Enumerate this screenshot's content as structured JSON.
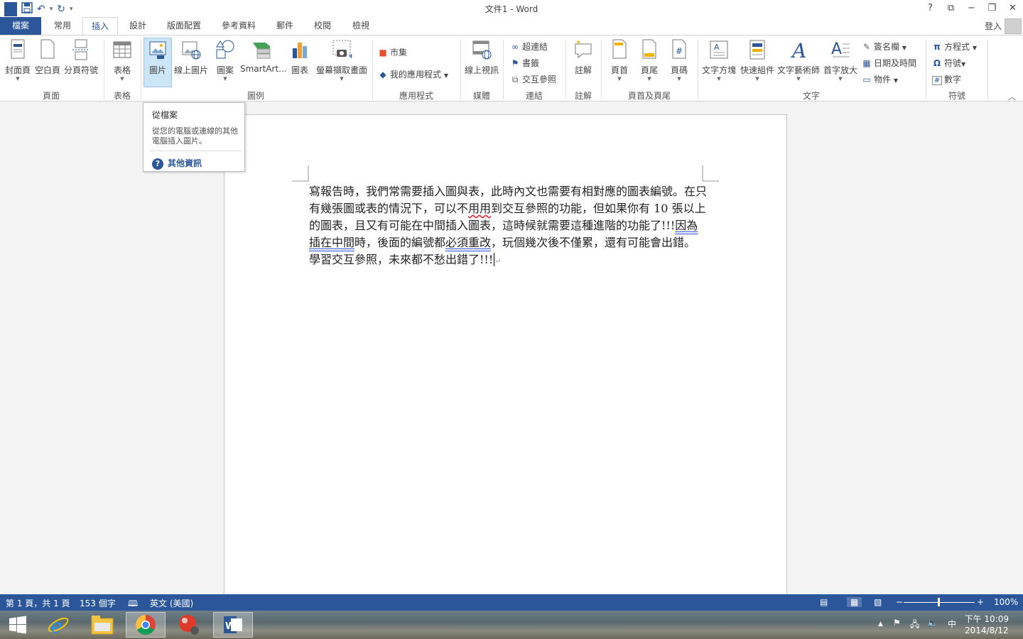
{
  "window": {
    "title": "文件1 - Word",
    "help": "?",
    "ribbon_display": "⧉",
    "restore": "❐",
    "close": "✕"
  },
  "qat": {
    "undo_arrow": "▾",
    "customize": "▾"
  },
  "tabs": [
    "檔案",
    "常用",
    "插入",
    "設計",
    "版面配置",
    "參考資料",
    "郵件",
    "校閱",
    "檢視"
  ],
  "active_tab": "插入",
  "account": {
    "login": "登入"
  },
  "ribbon": {
    "pages": {
      "cover": "封面頁",
      "blank": "空白頁",
      "break": "分頁符號",
      "group": "頁面"
    },
    "tables": {
      "table": "表格",
      "group": "表格"
    },
    "illustrations": {
      "picture": "圖片",
      "online": "線上圖片",
      "shapes": "圖案",
      "smartart": "SmartArt...",
      "chart": "圖表",
      "screenshot": "螢幕擷取畫面",
      "group": "圖例"
    },
    "apps": {
      "store": "市集",
      "myapps": "我的應用程式",
      "group": "應用程式"
    },
    "media": {
      "video": "線上視訊",
      "group": "媒體"
    },
    "links": {
      "hyperlink": "超連結",
      "bookmark": "書籤",
      "crossref": "交互參照",
      "group": "連結"
    },
    "comments": {
      "comment": "註解",
      "group": "註解"
    },
    "header_footer": {
      "header": "頁首",
      "footer": "頁尾",
      "pagenum": "頁碼",
      "group": "頁首及頁尾"
    },
    "text": {
      "textbox": "文字方塊",
      "quickparts": "快速組件",
      "wordart": "文字藝術師",
      "dropcap": "首字放大",
      "signature": "簽名欄",
      "datetime": "日期及時間",
      "object": "物件",
      "group": "文字"
    },
    "symbols": {
      "equation": "方程式",
      "symbol": "符號",
      "number": "數字",
      "group": "符號"
    }
  },
  "tooltip": {
    "title": "從檔案",
    "desc": "從您的電腦或連線的其他電腦插入圖片。",
    "help": "其他資訊"
  },
  "document": {
    "part1": "寫報告時，我們常需要插入圖與表，此時內文也需要有相對應的圖表編號。在只有幾張圖或表的情況下，可以不",
    "err1": "用用",
    "part2": "到交互參照的功能，但如果你有 10 張以上的圖表，且又有可能在中間插入圖表，這時候就需要這種進階的功能了!!!",
    "grammar1": "因為插在中間",
    "part3": "時，後面的編號都",
    "grammar2": "必須重改",
    "part4": "，玩個幾次後不僅累，還有可能會出錯。學習交互參照，未來都不愁出錯了!!!",
    "para_mark": "↵"
  },
  "status": {
    "page": "第 1 頁，共 1 頁",
    "words": "153 個字",
    "lang": "英文 (美國)",
    "zoom": "100%",
    "zoom_minus": "−",
    "zoom_plus": "+"
  },
  "taskbar": {
    "ime": "中",
    "time": "下午 10:09",
    "date": "2014/8/12",
    "tray_arrow": "▲"
  }
}
